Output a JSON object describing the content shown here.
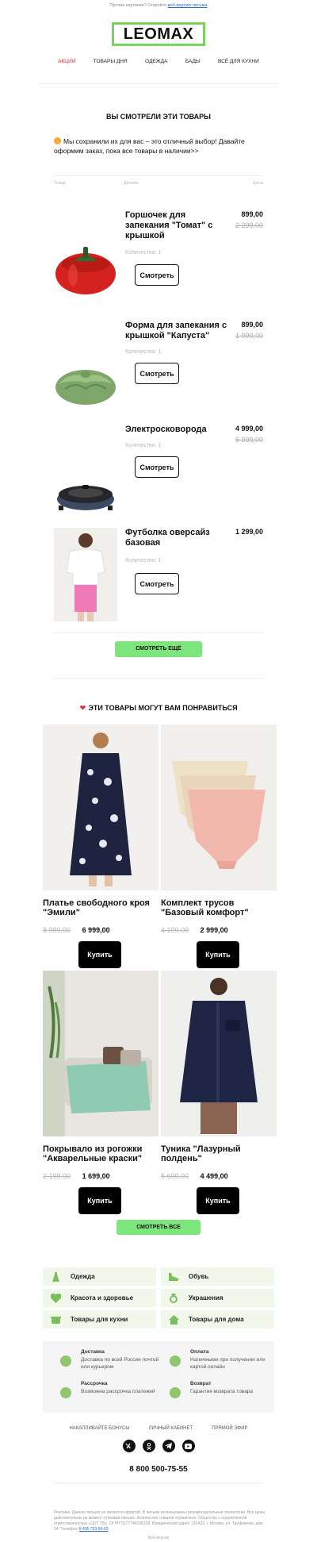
{
  "preheader": {
    "text": "Прочие картинки? Откройте",
    "link": "веб-версию письма"
  },
  "logo": "LEOMAX",
  "nav": [
    "Акции",
    "Товары дня",
    "Одежда",
    "Бады",
    "Всё для кухни"
  ],
  "viewed": {
    "title": "ВЫ СМОТРЕЛИ ЭТИ ТОВАРЫ",
    "intro": "Мы сохранили их для вас – это отличный выбор! Давайте оформим заказ, пока все товары в наличии>>",
    "columns": [
      "Товар",
      "Детали",
      "Цена"
    ],
    "items": [
      {
        "name": "Горшочек для запекания \"Томат\" с крышкой",
        "qty": "Количество: 1",
        "button": "Смотреть",
        "price": "899,00",
        "old_price": "2 299,00",
        "icon": "tomato-pot-icon"
      },
      {
        "name": "Форма для запекания с крышкой \"Капуста\"",
        "qty": "Количество: 1",
        "button": "Смотреть",
        "price": "899,00",
        "old_price": "1 999,00",
        "icon": "cabbage-dish-icon"
      },
      {
        "name": "Электросковорода",
        "qty": "Количество: 1",
        "button": "Смотреть",
        "price": "4 999,00",
        "old_price": "6 999,00",
        "icon": "electric-pan-icon"
      },
      {
        "name": "Футболка оверсайз базовая",
        "qty": "Количество: 1",
        "button": "Смотреть",
        "price": "1 299,00",
        "old_price": "",
        "icon": "tshirt-photo"
      }
    ],
    "more_button": "СМОТРЕТЬ ЕЩЁ"
  },
  "recommend": {
    "title": "ЭТИ ТОВАРЫ МОГУТ ВАМ ПОНРАВИТЬСЯ",
    "items": [
      {
        "name": "Платье свободного кроя \"Эмили\"",
        "old_price": "8 999,00",
        "price": "6 999,00",
        "button": "Купить"
      },
      {
        "name": "Комплект трусов \"Базовый комфорт\"",
        "old_price": "4 199,00",
        "price": "2 999,00",
        "button": "Купить"
      },
      {
        "name": "Покрывало из рогожки \"Акварельные краски\"",
        "old_price": "2 199,00",
        "price": "1 699,00",
        "button": "Купить"
      },
      {
        "name": "Туника \"Лазурный полдень\"",
        "old_price": "5 699,00",
        "price": "4 499,00",
        "button": "Купить"
      }
    ],
    "all_button": "СМОТРЕТЬ ВСЕ"
  },
  "categories": [
    {
      "label": "Одежда",
      "icon": "dress-icon"
    },
    {
      "label": "Обувь",
      "icon": "shoe-icon"
    },
    {
      "label": "Красота и здоровье",
      "icon": "heart-icon"
    },
    {
      "label": "Украшения",
      "icon": "ring-icon"
    },
    {
      "label": "Товары для кухни",
      "icon": "pot-icon"
    },
    {
      "label": "Товары для дома",
      "icon": "house-icon"
    }
  ],
  "info": [
    {
      "title": "Доставка",
      "desc": "Доставка по всей России почтой или курьером",
      "icon": "box-icon"
    },
    {
      "title": "Оплата",
      "desc": "Наличными при получении или картой онлайн",
      "icon": "ruble-icon"
    },
    {
      "title": "Рассрочка",
      "desc": "Возможна рассрочка платежей",
      "icon": "clock-icon"
    },
    {
      "title": "Возврат",
      "desc": "Гарантия возврата товара",
      "icon": "return-icon"
    }
  ],
  "footer": {
    "links": [
      "Накапливайте бонусы",
      "Личный кабинет",
      "Прямой эфир"
    ],
    "socials": [
      "vk-icon",
      "ok-icon",
      "telegram-icon",
      "youtube-icon"
    ],
    "phone": "8 800 500-75-55",
    "legal": "Реклама. Данное письмо не является офертой. В письме использованы рекомендательные технологии. Все цены действительны на момент отправки письма. Количество товаров ограничено. Общество с ограниченной ответственностью «ЦОТ ТВ». ОГРН 5177746038128. Юридический адрес: 115432, г. Москва, ул. Трофимова, дом 24. Телефон:",
    "legal_phone": "8 495 733-96-03",
    "webversion": "Веб-версия"
  },
  "colors": {
    "accent_green": "#7ce57b",
    "logo_border": "#7ad35a",
    "active_nav": "#e02727",
    "category_bg": "#f1f7ea"
  }
}
